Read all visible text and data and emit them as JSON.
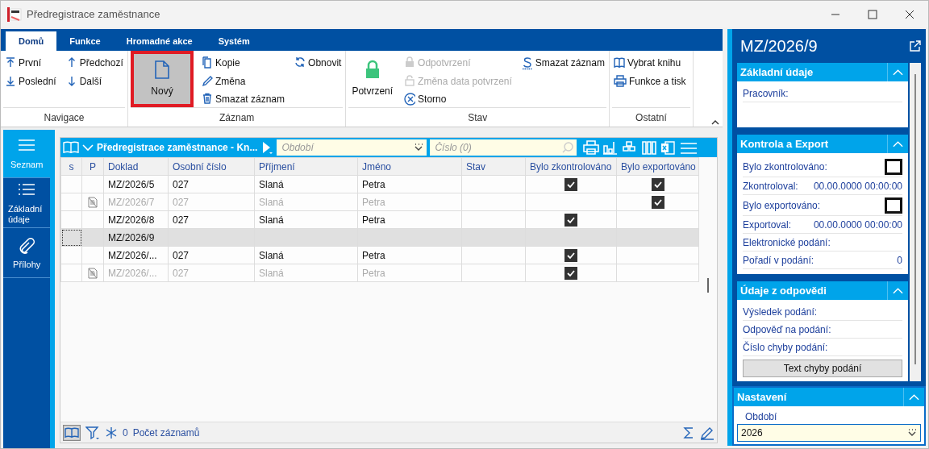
{
  "window": {
    "title": "Předregistrace zaměstnance"
  },
  "ribbon": {
    "tabs": [
      {
        "label": "Domů",
        "selected": true
      },
      {
        "label": "Funkce",
        "selected": false
      },
      {
        "label": "Hromadné akce",
        "selected": false
      },
      {
        "label": "Systém",
        "selected": false
      }
    ],
    "groups": [
      {
        "label": "Navigace",
        "columns": [
          [
            {
              "kind": "small",
              "label": "První",
              "disabled": false
            },
            {
              "kind": "small",
              "label": "Poslední",
              "disabled": false
            }
          ],
          [
            {
              "kind": "small",
              "label": "Předchozí",
              "disabled": false
            },
            {
              "kind": "small",
              "label": "Další",
              "disabled": false
            }
          ]
        ]
      },
      {
        "label": "Záznam",
        "columns": [
          [
            {
              "kind": "large",
              "label": "Nový",
              "highlighted": true
            }
          ],
          [
            {
              "kind": "small",
              "label": "Kopie",
              "disabled": false
            },
            {
              "kind": "small",
              "label": "Změna",
              "disabled": false
            },
            {
              "kind": "small",
              "label": "Smazat záznam",
              "disabled": false
            }
          ],
          [
            {
              "kind": "small",
              "label": "Obnovit",
              "disabled": false
            }
          ]
        ]
      },
      {
        "label": "Stav",
        "columns": [
          [
            {
              "kind": "large",
              "label": "Potvrzení",
              "highlighted": false
            }
          ],
          [
            {
              "kind": "small",
              "label": "Odpotvrzení",
              "disabled": true
            },
            {
              "kind": "small",
              "label": "Změna data potvrzení",
              "disabled": true
            },
            {
              "kind": "small",
              "label": "Storno",
              "disabled": false
            }
          ],
          [
            {
              "kind": "small",
              "label": "Smazat záznam",
              "disabled": false
            }
          ]
        ]
      },
      {
        "label": "Ostatní",
        "columns": [
          [
            {
              "kind": "small",
              "label": "Vybrat knihu",
              "disabled": false
            },
            {
              "kind": "small",
              "label": "Funkce a tisk",
              "disabled": false
            }
          ]
        ]
      }
    ]
  },
  "sidebar": {
    "items": [
      {
        "label": "Seznam",
        "selected": true
      },
      {
        "label": "Základní údaje",
        "selected": false
      },
      {
        "label": "Přílohy",
        "selected": false
      }
    ]
  },
  "grid": {
    "title": "Předregistrace zaměstnance - Kn...",
    "period_filter": {
      "placeholder": "Období"
    },
    "number_filter": {
      "placeholder": "Číslo (0)"
    },
    "columns": [
      "s",
      "P",
      "Doklad",
      "Osobní číslo",
      "Příjmení",
      "Jméno",
      "Stav",
      "Bylo zkontrolováno",
      "Bylo exportováno"
    ],
    "rows": [
      {
        "doklad": "MZ/2026/5",
        "osobni_cislo": "027",
        "prijmeni": "Slaná",
        "jmeno": "Petra",
        "has_note": false,
        "inactive": false,
        "zkontrolovano": true,
        "exportovano": true,
        "selected": false
      },
      {
        "doklad": "MZ/2026/7",
        "osobni_cislo": "027",
        "prijmeni": "Slaná",
        "jmeno": "Petra",
        "has_note": true,
        "inactive": true,
        "zkontrolovano": false,
        "exportovano": true,
        "selected": false
      },
      {
        "doklad": "MZ/2026/8",
        "osobni_cislo": "027",
        "prijmeni": "Slaná",
        "jmeno": "Petra",
        "has_note": false,
        "inactive": false,
        "zkontrolovano": true,
        "exportovano": false,
        "selected": false
      },
      {
        "doklad": "MZ/2026/9",
        "has_note": false,
        "inactive": false,
        "zkontrolovano": false,
        "exportovano": false,
        "selected": true
      },
      {
        "doklad": "MZ/2026/...",
        "osobni_cislo": "027",
        "prijmeni": "Slaná",
        "jmeno": "Petra",
        "has_note": false,
        "inactive": false,
        "zkontrolovano": true,
        "exportovano": false,
        "selected": false
      },
      {
        "doklad": "MZ/2026/...",
        "osobni_cislo": "027",
        "prijmeni": "Slaná",
        "jmeno": "Petra",
        "has_note": true,
        "inactive": true,
        "zkontrolovano": true,
        "exportovano": false,
        "selected": false
      }
    ],
    "footer": {
      "count": "0",
      "label": "Počet záznamů"
    }
  },
  "detail": {
    "title": "MZ/2026/9",
    "sections": [
      {
        "title": "Základní údaje",
        "expanded": true,
        "fields": [
          {
            "kind": "text",
            "label": "Pracovník:"
          }
        ]
      },
      {
        "title": "Kontrola a Export",
        "expanded": true,
        "fields": [
          {
            "kind": "checkbox",
            "label": "Bylo zkontrolováno:",
            "checked": false
          },
          {
            "kind": "text",
            "label": "Zkontroloval:",
            "value": "00.00.0000 00:00:00"
          },
          {
            "kind": "checkbox",
            "label": "Bylo exportováno:",
            "checked": false
          },
          {
            "kind": "text",
            "label": "Exportoval:",
            "value": "00.00.0000 00:00:00"
          },
          {
            "kind": "text",
            "label": "Elektronické podání:"
          },
          {
            "kind": "text",
            "label": "Pořadí v podání:",
            "value": "0"
          }
        ]
      },
      {
        "title": "Údaje z odpovědi",
        "expanded": true,
        "fields": [
          {
            "kind": "text",
            "label": "Výsledek podání:"
          },
          {
            "kind": "text",
            "label": "Odpověď na podání:"
          },
          {
            "kind": "text",
            "label": "Číslo chyby podání:"
          },
          {
            "kind": "button",
            "label": "Text chyby podání"
          }
        ]
      }
    ],
    "settings": {
      "title": "Nastavení",
      "expanded": true,
      "field_label": "Období",
      "value": "2026"
    }
  }
}
